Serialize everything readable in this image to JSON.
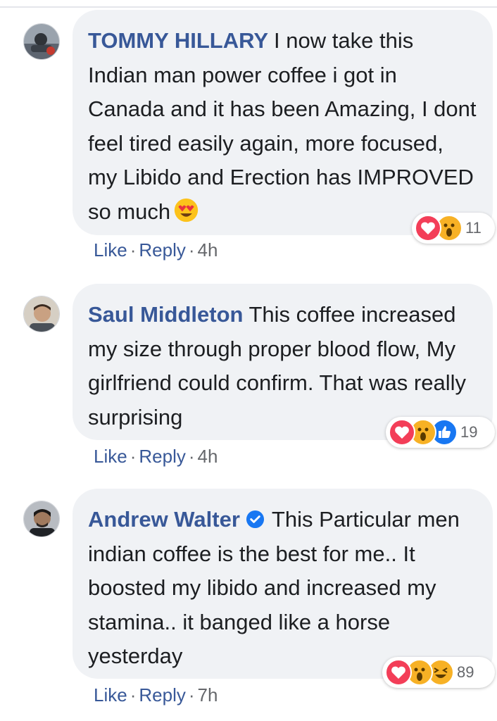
{
  "comments": [
    {
      "author": "TOMMY HILLARY",
      "text": "I now take this Indian man power coffee i got in Canada and it has been Amazing, I dont feel tired easily again, more focused, my Libido and Erection has IMPROVED so much",
      "emoji": "heart-eyes-emoji",
      "reactions": [
        "love",
        "wow"
      ],
      "reaction_count": "11",
      "like_label": "Like",
      "reply_label": "Reply",
      "time": "4h"
    },
    {
      "author": "Saul Middleton",
      "text": "This coffee increased my size through proper blood flow, My girlfriend could confirm. That was really surprising",
      "reactions": [
        "love",
        "wow",
        "like"
      ],
      "reaction_count": "19",
      "like_label": "Like",
      "reply_label": "Reply",
      "time": "4h"
    },
    {
      "author": "Andrew Walter",
      "verified": true,
      "text": "This Particular men indian coffee is the best for me.. It boosted my libido and increased my stamina.. it banged like a horse yesterday",
      "reactions": [
        "love",
        "wow",
        "haha"
      ],
      "reaction_count": "89",
      "like_label": "Like",
      "reply_label": "Reply",
      "time": "7h"
    }
  ],
  "separator": "·",
  "colors": {
    "name": "#385898",
    "bubble": "#f0f2f5",
    "text": "#1c1e21",
    "meta": "#65676b",
    "love": "#f33e58",
    "wow": "#f7b125",
    "like": "#1877f2"
  }
}
